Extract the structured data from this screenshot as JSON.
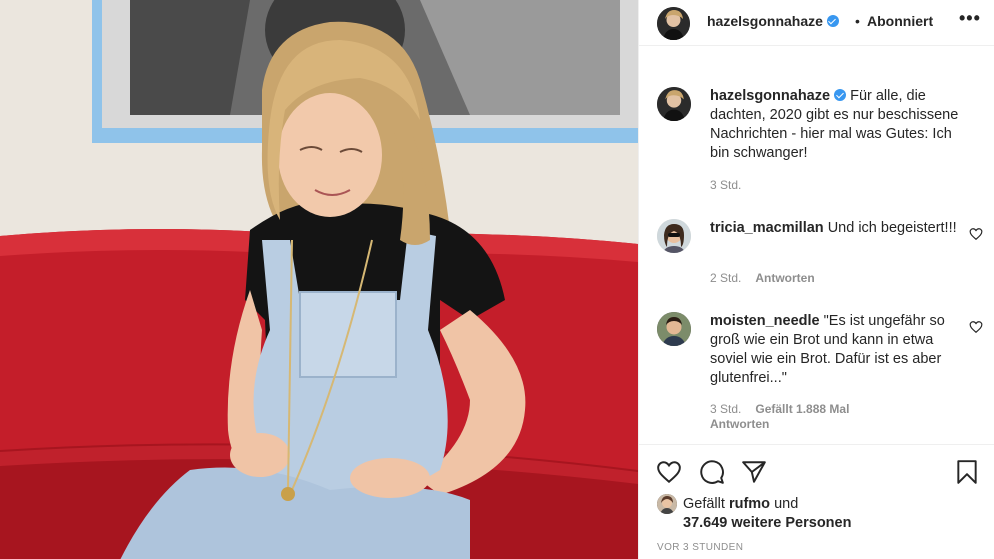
{
  "post": {
    "username": "hazelsgonnahaze",
    "follow_separator": "•",
    "follow_status": "Abonniert",
    "more_label": "•••"
  },
  "caption": {
    "username": "hazelsgonnahaze",
    "text": "Für alle, die dachten, 2020 gibt es nur beschissene Nachrichten - hier mal was Gutes: Ich bin schwanger!",
    "time": "3 Std."
  },
  "comments": [
    {
      "username": "tricia_macmillan",
      "text": "Und ich begeistert!!!",
      "time": "2 Std.",
      "likes": "",
      "reply_label": "Antworten"
    },
    {
      "username": "moisten_needle",
      "text": "\"Es ist ungefähr so groß wie ein Brot und kann in etwa soviel wie ein Brot. Dafür ist es aber glutenfrei...\"",
      "time": "3 Std.",
      "likes": "Gefällt 1.888 Mal",
      "reply_label": "Antworten"
    }
  ],
  "likes": {
    "prefix": "Gefällt",
    "liker": "rufmo",
    "joiner": "und",
    "others": "37.649 weitere Personen"
  },
  "timestamp": "VOR 3 STUNDEN",
  "icons": [
    "heart-icon",
    "comment-icon",
    "share-icon",
    "bookmark-icon",
    "verified-badge-icon",
    "more-icon"
  ],
  "colors": {
    "verified": "#3897f0",
    "text": "#262626",
    "muted": "#8e8e8e",
    "sofa": "#c8202a"
  }
}
